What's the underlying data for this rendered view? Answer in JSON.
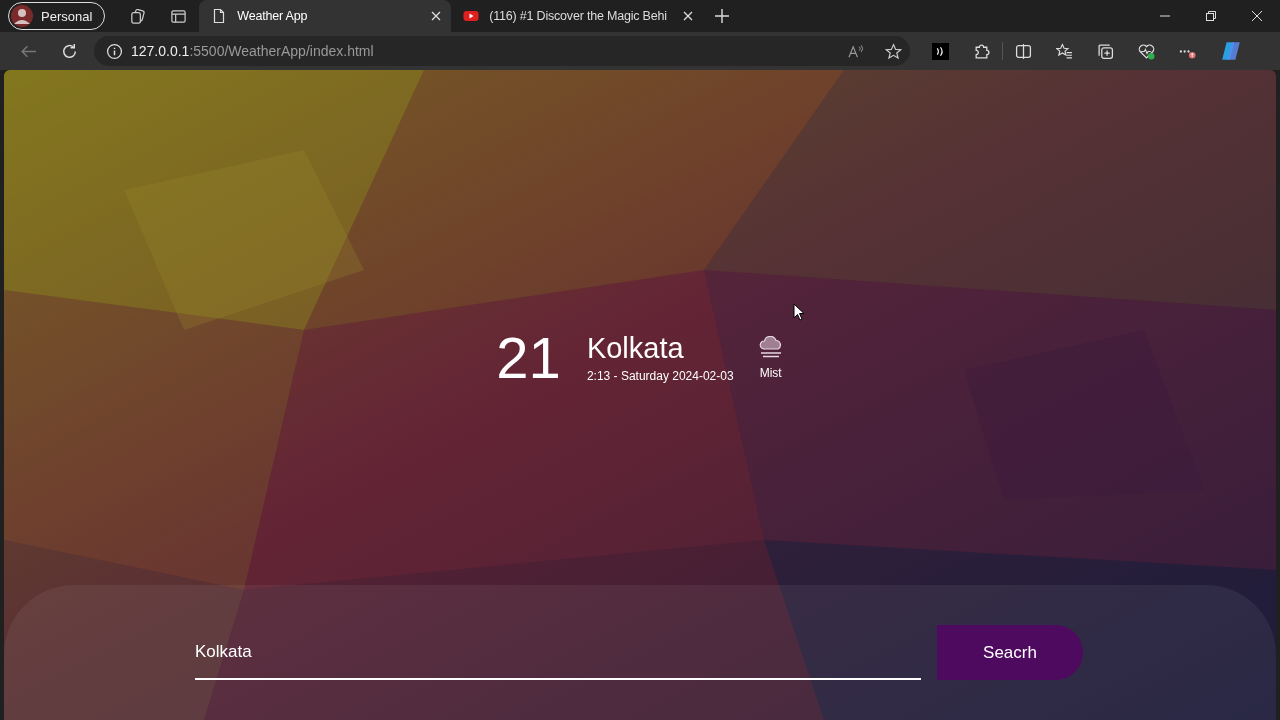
{
  "browser": {
    "profile": "Personal",
    "tabs": [
      {
        "kind": "page",
        "title": "Weather App",
        "selected": true
      },
      {
        "kind": "video",
        "title": "(116) #1 Discover the Magic Behi",
        "selected": false
      }
    ],
    "address": {
      "host": "127.0.0.1",
      "path": ":5500/WeatherApp/index.html"
    }
  },
  "page": {
    "weather": {
      "temperature": "21",
      "city": "Kolkata",
      "datetime": "2:13 - Saturday 2024-02-03",
      "condition": "Mist"
    },
    "search": {
      "value": "Kolkata",
      "button": "Seacrh"
    }
  }
}
